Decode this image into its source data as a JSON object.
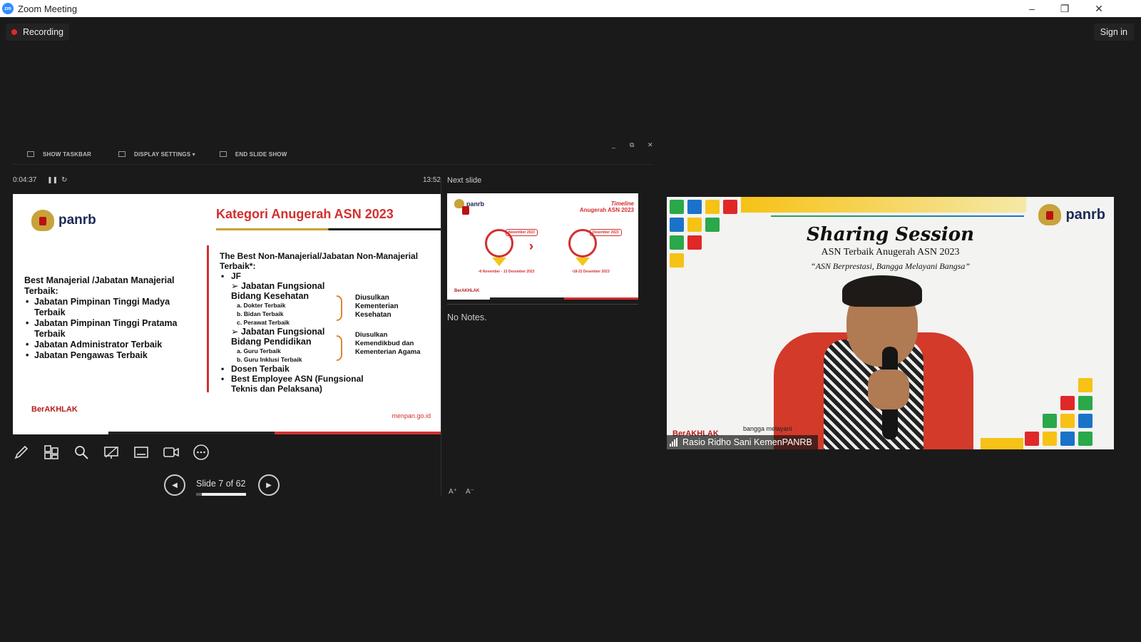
{
  "window": {
    "app_icon_text": "zm",
    "title": "Zoom Meeting",
    "minimize": "–",
    "restore": "❐",
    "close": "✕"
  },
  "recording": {
    "label": "Recording"
  },
  "sign_in": {
    "label": "Sign in"
  },
  "presenter": {
    "toolbar": {
      "show_taskbar": "SHOW TASKBAR",
      "display_settings": "DISPLAY SETTINGS ▾",
      "end_slide_show": "END SLIDE SHOW",
      "minimize": "_",
      "restore": "⧉",
      "close": "✕"
    },
    "timer": "0:04:37",
    "pause_glyph": "❚❚",
    "restart_glyph": "↻",
    "clock": "13:52",
    "slide": {
      "logo": "panrb",
      "title": "Kategori Anugerah ASN 2023",
      "left_heading": "Best Manajerial /Jabatan Manajerial Terbaik:",
      "left_items": [
        "Jabatan Pimpinan Tinggi Madya Terbaik",
        "Jabatan Pimpinan Tinggi Pratama Terbaik",
        "Jabatan Administrator Terbaik",
        "Jabatan Pengawas Terbaik"
      ],
      "right_heading": "The Best Non-Manajerial/Jabatan Non-Manajerial Terbaik*:",
      "jf": "JF",
      "kesehatan_heading": "➢ Jabatan Fungsional Bidang Kesehatan",
      "kesehatan_items": [
        "a.  Dokter Terbaik",
        "b.  Bidan Terbaik",
        "c.  Perawat Terbaik"
      ],
      "kesehatan_note": "Diusulkan Kementerian Kesehatan",
      "pendidikan_heading": "➢ Jabatan Fungsional Bidang Pendidikan",
      "pendidikan_items": [
        "a.  Guru Terbaik",
        "b.  Guru Inklusi Terbaik"
      ],
      "pendidikan_note": "Diusulkan Kemendikbud dan Kementerian Agama",
      "dosen": "Dosen Terbaik",
      "best_employee": "Best Employee ASN (Fungsional Teknis dan Pelaksana)",
      "footer_brand": "BerAKHLAK",
      "footer_url": "menpan.go.id"
    },
    "tools": [
      "pen-tool-icon",
      "grid-view-icon",
      "zoom-icon",
      "pointer-screen-icon",
      "subtitles-icon",
      "camera-icon",
      "more-icon"
    ],
    "nav": {
      "prev_glyph": "◀",
      "next_glyph": "▶",
      "counter": "Slide 7 of 62",
      "progress": 0.113
    },
    "next_slide": {
      "label": "Next slide",
      "logo": "panrb",
      "title_line1": "Timeline",
      "title_line2": "Anugerah ASN 2023",
      "bubble1": "November 2023",
      "bubble2": "Desember 2023",
      "date1": "•6 November - 13 Desember 2023",
      "date2": "•18-22 Desember 2023",
      "footer_brand": "BerAKHLAK"
    },
    "notes": "No Notes.",
    "font_increase": "A⁺",
    "font_decrease": "A⁻"
  },
  "video": {
    "logo": "panrb",
    "title": "Sharing Session",
    "subtitle": "ASN Terbaik  Anugerah ASN 2023",
    "tagline": "“ASN Berprestasi, Bangga Melayani Bangsa”",
    "footer_brand": "BerAKHLAK",
    "footer_bangga": "bangga melayani",
    "participant_name": "Rasio Ridho Sani KemenPANRB"
  }
}
